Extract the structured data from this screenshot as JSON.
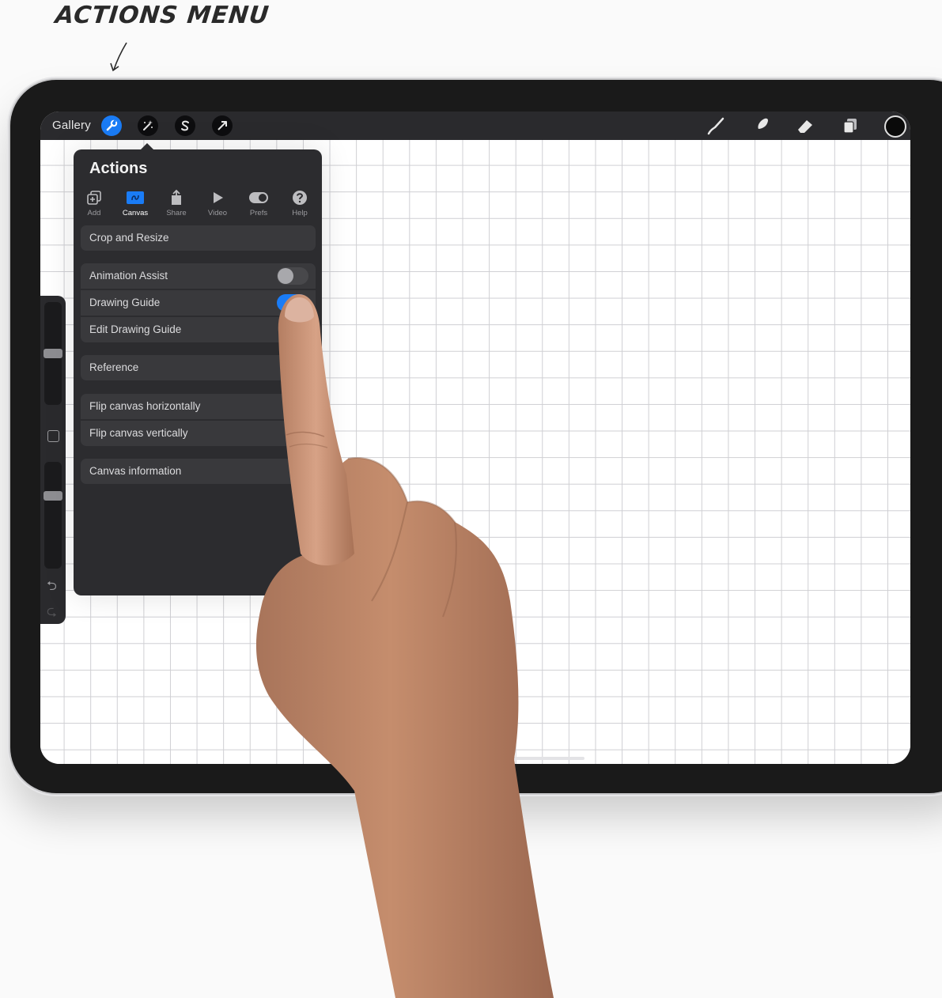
{
  "callout": {
    "label": "ACTIONS MENU"
  },
  "topbar": {
    "gallery_label": "Gallery",
    "left_icons": [
      "wrench-icon",
      "magic-wand-icon",
      "selection-s-icon",
      "transform-arrow-icon"
    ],
    "right_icons": [
      "brush-icon",
      "smudge-icon",
      "eraser-icon",
      "layers-icon",
      "color-swatch"
    ],
    "current_color": "#0a0a0a",
    "accent": "#1a7cf6"
  },
  "actions_panel": {
    "title": "Actions",
    "tabs": [
      {
        "label": "Add",
        "icon": "add-icon",
        "active": false
      },
      {
        "label": "Canvas",
        "icon": "canvas-icon",
        "active": true
      },
      {
        "label": "Share",
        "icon": "share-icon",
        "active": false
      },
      {
        "label": "Video",
        "icon": "play-icon",
        "active": false
      },
      {
        "label": "Prefs",
        "icon": "toggle-icon",
        "active": false
      },
      {
        "label": "Help",
        "icon": "help-icon",
        "active": false
      }
    ],
    "items": {
      "crop": "Crop and Resize",
      "animation_assist": "Animation Assist",
      "drawing_guide": "Drawing Guide",
      "edit_drawing_guide": "Edit Drawing Guide",
      "reference": "Reference",
      "flip_h": "Flip canvas horizontally",
      "flip_v": "Flip canvas vertically",
      "canvas_info": "Canvas information"
    },
    "toggles": {
      "animation_assist": false,
      "drawing_guide": true
    }
  },
  "sidebar": {
    "brush_size_level": 0.5,
    "opacity_level": 0.68,
    "undo_icon": "undo-icon",
    "redo_icon": "redo-icon"
  }
}
